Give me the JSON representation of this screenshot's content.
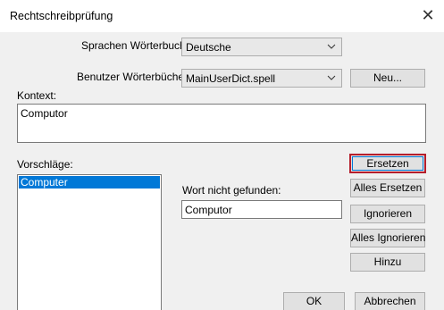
{
  "window": {
    "title": "Rechtschreibprüfung",
    "close_glyph": "✕"
  },
  "dictionary": {
    "language_label": "Sprachen Wörterbuch:",
    "language_value": "Deutsche",
    "user_label": "Benutzer Wörterbücher",
    "user_value": "MainUserDict.spell",
    "new_button": "Neu..."
  },
  "context": {
    "label": "Kontext:",
    "text": "Computor"
  },
  "suggestions": {
    "label": "Vorschläge:",
    "items": [
      "Computer"
    ],
    "selected_index": 0
  },
  "not_found": {
    "label": "Wort nicht gefunden:",
    "value": "Computor"
  },
  "buttons": {
    "replace": "Ersetzen",
    "replace_all": "Alles Ersetzen",
    "ignore": "Ignorieren",
    "ignore_all": "Alles Ignorieren",
    "add": "Hinzu",
    "ok": "OK",
    "cancel": "Abbrechen"
  },
  "colors": {
    "default_button_border": "#b51e2c",
    "selection": "#0078d7"
  }
}
